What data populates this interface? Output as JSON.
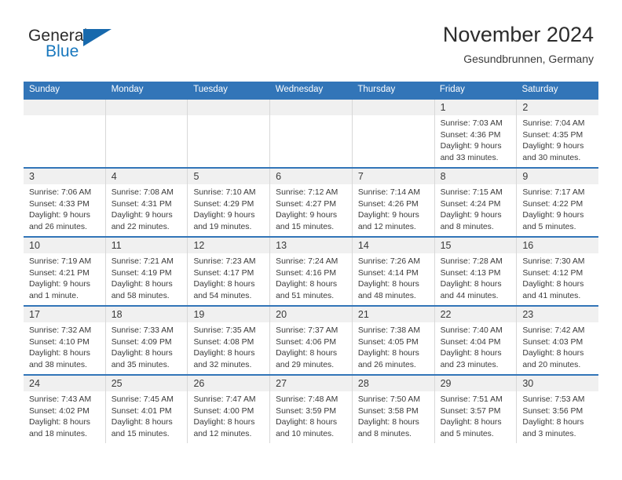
{
  "brand": {
    "name_part1": "General",
    "name_part2": "Blue",
    "triangle_color": "#1769ad",
    "blue_text_color": "#1878be"
  },
  "header": {
    "title": "November 2024",
    "subtitle": "Gesundbrunnen, Germany"
  },
  "colors": {
    "header_bar": "#3275b8",
    "day_band": "#f0f0f0",
    "cell_border": "#d8d8d8",
    "text": "#3a3a3a"
  },
  "weekdays": [
    "Sunday",
    "Monday",
    "Tuesday",
    "Wednesday",
    "Thursday",
    "Friday",
    "Saturday"
  ],
  "weeks": [
    [
      {
        "day": "",
        "empty": true
      },
      {
        "day": "",
        "empty": true
      },
      {
        "day": "",
        "empty": true
      },
      {
        "day": "",
        "empty": true
      },
      {
        "day": "",
        "empty": true
      },
      {
        "day": "1",
        "sunrise": "Sunrise: 7:03 AM",
        "sunset": "Sunset: 4:36 PM",
        "daylight1": "Daylight: 9 hours",
        "daylight2": "and 33 minutes."
      },
      {
        "day": "2",
        "sunrise": "Sunrise: 7:04 AM",
        "sunset": "Sunset: 4:35 PM",
        "daylight1": "Daylight: 9 hours",
        "daylight2": "and 30 minutes."
      }
    ],
    [
      {
        "day": "3",
        "sunrise": "Sunrise: 7:06 AM",
        "sunset": "Sunset: 4:33 PM",
        "daylight1": "Daylight: 9 hours",
        "daylight2": "and 26 minutes."
      },
      {
        "day": "4",
        "sunrise": "Sunrise: 7:08 AM",
        "sunset": "Sunset: 4:31 PM",
        "daylight1": "Daylight: 9 hours",
        "daylight2": "and 22 minutes."
      },
      {
        "day": "5",
        "sunrise": "Sunrise: 7:10 AM",
        "sunset": "Sunset: 4:29 PM",
        "daylight1": "Daylight: 9 hours",
        "daylight2": "and 19 minutes."
      },
      {
        "day": "6",
        "sunrise": "Sunrise: 7:12 AM",
        "sunset": "Sunset: 4:27 PM",
        "daylight1": "Daylight: 9 hours",
        "daylight2": "and 15 minutes."
      },
      {
        "day": "7",
        "sunrise": "Sunrise: 7:14 AM",
        "sunset": "Sunset: 4:26 PM",
        "daylight1": "Daylight: 9 hours",
        "daylight2": "and 12 minutes."
      },
      {
        "day": "8",
        "sunrise": "Sunrise: 7:15 AM",
        "sunset": "Sunset: 4:24 PM",
        "daylight1": "Daylight: 9 hours",
        "daylight2": "and 8 minutes."
      },
      {
        "day": "9",
        "sunrise": "Sunrise: 7:17 AM",
        "sunset": "Sunset: 4:22 PM",
        "daylight1": "Daylight: 9 hours",
        "daylight2": "and 5 minutes."
      }
    ],
    [
      {
        "day": "10",
        "sunrise": "Sunrise: 7:19 AM",
        "sunset": "Sunset: 4:21 PM",
        "daylight1": "Daylight: 9 hours",
        "daylight2": "and 1 minute."
      },
      {
        "day": "11",
        "sunrise": "Sunrise: 7:21 AM",
        "sunset": "Sunset: 4:19 PM",
        "daylight1": "Daylight: 8 hours",
        "daylight2": "and 58 minutes."
      },
      {
        "day": "12",
        "sunrise": "Sunrise: 7:23 AM",
        "sunset": "Sunset: 4:17 PM",
        "daylight1": "Daylight: 8 hours",
        "daylight2": "and 54 minutes."
      },
      {
        "day": "13",
        "sunrise": "Sunrise: 7:24 AM",
        "sunset": "Sunset: 4:16 PM",
        "daylight1": "Daylight: 8 hours",
        "daylight2": "and 51 minutes."
      },
      {
        "day": "14",
        "sunrise": "Sunrise: 7:26 AM",
        "sunset": "Sunset: 4:14 PM",
        "daylight1": "Daylight: 8 hours",
        "daylight2": "and 48 minutes."
      },
      {
        "day": "15",
        "sunrise": "Sunrise: 7:28 AM",
        "sunset": "Sunset: 4:13 PM",
        "daylight1": "Daylight: 8 hours",
        "daylight2": "and 44 minutes."
      },
      {
        "day": "16",
        "sunrise": "Sunrise: 7:30 AM",
        "sunset": "Sunset: 4:12 PM",
        "daylight1": "Daylight: 8 hours",
        "daylight2": "and 41 minutes."
      }
    ],
    [
      {
        "day": "17",
        "sunrise": "Sunrise: 7:32 AM",
        "sunset": "Sunset: 4:10 PM",
        "daylight1": "Daylight: 8 hours",
        "daylight2": "and 38 minutes."
      },
      {
        "day": "18",
        "sunrise": "Sunrise: 7:33 AM",
        "sunset": "Sunset: 4:09 PM",
        "daylight1": "Daylight: 8 hours",
        "daylight2": "and 35 minutes."
      },
      {
        "day": "19",
        "sunrise": "Sunrise: 7:35 AM",
        "sunset": "Sunset: 4:08 PM",
        "daylight1": "Daylight: 8 hours",
        "daylight2": "and 32 minutes."
      },
      {
        "day": "20",
        "sunrise": "Sunrise: 7:37 AM",
        "sunset": "Sunset: 4:06 PM",
        "daylight1": "Daylight: 8 hours",
        "daylight2": "and 29 minutes."
      },
      {
        "day": "21",
        "sunrise": "Sunrise: 7:38 AM",
        "sunset": "Sunset: 4:05 PM",
        "daylight1": "Daylight: 8 hours",
        "daylight2": "and 26 minutes."
      },
      {
        "day": "22",
        "sunrise": "Sunrise: 7:40 AM",
        "sunset": "Sunset: 4:04 PM",
        "daylight1": "Daylight: 8 hours",
        "daylight2": "and 23 minutes."
      },
      {
        "day": "23",
        "sunrise": "Sunrise: 7:42 AM",
        "sunset": "Sunset: 4:03 PM",
        "daylight1": "Daylight: 8 hours",
        "daylight2": "and 20 minutes."
      }
    ],
    [
      {
        "day": "24",
        "sunrise": "Sunrise: 7:43 AM",
        "sunset": "Sunset: 4:02 PM",
        "daylight1": "Daylight: 8 hours",
        "daylight2": "and 18 minutes."
      },
      {
        "day": "25",
        "sunrise": "Sunrise: 7:45 AM",
        "sunset": "Sunset: 4:01 PM",
        "daylight1": "Daylight: 8 hours",
        "daylight2": "and 15 minutes."
      },
      {
        "day": "26",
        "sunrise": "Sunrise: 7:47 AM",
        "sunset": "Sunset: 4:00 PM",
        "daylight1": "Daylight: 8 hours",
        "daylight2": "and 12 minutes."
      },
      {
        "day": "27",
        "sunrise": "Sunrise: 7:48 AM",
        "sunset": "Sunset: 3:59 PM",
        "daylight1": "Daylight: 8 hours",
        "daylight2": "and 10 minutes."
      },
      {
        "day": "28",
        "sunrise": "Sunrise: 7:50 AM",
        "sunset": "Sunset: 3:58 PM",
        "daylight1": "Daylight: 8 hours",
        "daylight2": "and 8 minutes."
      },
      {
        "day": "29",
        "sunrise": "Sunrise: 7:51 AM",
        "sunset": "Sunset: 3:57 PM",
        "daylight1": "Daylight: 8 hours",
        "daylight2": "and 5 minutes."
      },
      {
        "day": "30",
        "sunrise": "Sunrise: 7:53 AM",
        "sunset": "Sunset: 3:56 PM",
        "daylight1": "Daylight: 8 hours",
        "daylight2": "and 3 minutes."
      }
    ]
  ]
}
